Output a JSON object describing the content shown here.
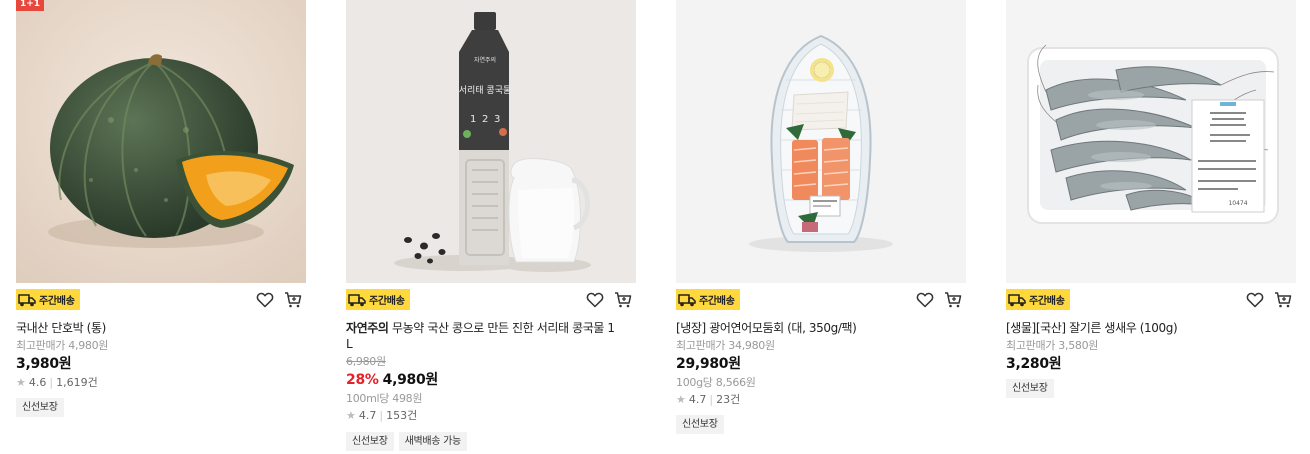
{
  "colors": {
    "delivery_badge": "#ffd83d",
    "discount": "#e3222a",
    "promo_badge": "#e8473c"
  },
  "products": [
    {
      "promo_badge": "1+1",
      "delivery": "주간배송",
      "brand": "",
      "name": "국내산 단호박 (통)",
      "original_price": "최고판매가 4,980원",
      "discount": "",
      "price": "3,980원",
      "unit_price": "",
      "rating": "4.6",
      "reviews": "1,619건",
      "tags": [
        "신선보장"
      ]
    },
    {
      "delivery": "주간배송",
      "brand": "자연주의",
      "name": "무농약 국산 콩으로 만든 진한 서리태 콩국물 1 L",
      "original_price": "6,980원",
      "discount": "28%",
      "price": "4,980원",
      "unit_price": "100ml당 498원",
      "rating": "4.7",
      "reviews": "153건",
      "tags": [
        "신선보장",
        "새벽배송 가능"
      ],
      "bottle_label_brand": "자연주의",
      "bottle_label_title": "서리태 콩국물",
      "bottle_label_steps": [
        "1",
        "2",
        "3"
      ]
    },
    {
      "delivery": "주간배송",
      "brand": "",
      "name": "[냉장] 광어연어모둠회 (대, 350g/팩)",
      "original_price": "최고판매가 34,980원",
      "discount": "",
      "price": "29,980원",
      "unit_price": "100g당 8,566원",
      "rating": "4.7",
      "reviews": "23건",
      "tags": [
        "신선보장"
      ]
    },
    {
      "delivery": "주간배송",
      "brand": "",
      "name": "[생물][국산] 잘기른 생새우 (100g)",
      "original_price": "최고판매가 3,580원",
      "discount": "",
      "price": "3,280원",
      "unit_price": "",
      "rating": "",
      "reviews": "",
      "tags": [
        "신선보장"
      ],
      "package_label_code": "10474"
    }
  ]
}
